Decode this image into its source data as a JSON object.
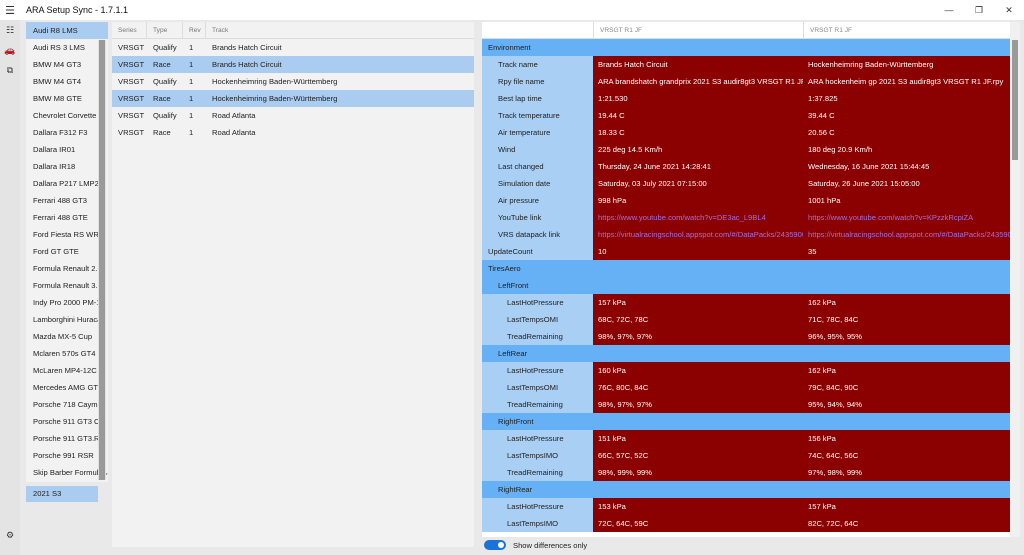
{
  "app": {
    "title": "ARA Setup Sync - 1.7.1.1"
  },
  "window": {
    "minimize": "—",
    "maximize": "❐",
    "close": "✕"
  },
  "cars": [
    "Audi R8 LMS",
    "Audi RS 3 LMS",
    "BMW M4 GT3",
    "BMW M4 GT4",
    "BMW M8 GTE",
    "Chevrolet Corvette C",
    "Dallara F312 F3",
    "Dallara IR01",
    "Dallara IR18",
    "Dallara P217 LMP2",
    "Ferrari 488 GT3",
    "Ferrari 488 GTE",
    "Ford Fiesta RS WRC",
    "Ford GT GTE",
    "Formula Renault 2.0",
    "Formula Renault 3.5",
    "Indy Pro 2000 PM-1",
    "Lamborghini Huraca",
    "Mazda MX-5 Cup",
    "Mclaren 570s GT4",
    "McLaren MP4-12C G",
    "Mercedes AMG GT3",
    "Porsche 718 Cayma",
    "Porsche 911 GT3 Cu",
    "Porsche 911 GT3.R",
    "Porsche 991 RSR",
    "Skip Barber Formula"
  ],
  "selected_car_index": 0,
  "season": "2021 S3",
  "setups": {
    "headers": {
      "series": "Series",
      "type": "Type",
      "rev": "Rev",
      "track": "Track"
    },
    "rows": [
      {
        "series": "VRSGT",
        "type": "Qualify",
        "rev": "1",
        "track": "Brands Hatch Circuit",
        "selected": false
      },
      {
        "series": "VRSGT",
        "type": "Race",
        "rev": "1",
        "track": "Brands Hatch Circuit",
        "selected": true
      },
      {
        "series": "VRSGT",
        "type": "Qualify",
        "rev": "1",
        "track": "Hockenheimring Baden-Württemberg",
        "selected": false
      },
      {
        "series": "VRSGT",
        "type": "Race",
        "rev": "1",
        "track": "Hockenheimring Baden-Württemberg",
        "selected": true
      },
      {
        "series": "VRSGT",
        "type": "Qualify",
        "rev": "1",
        "track": "Road Atlanta",
        "selected": false
      },
      {
        "series": "VRSGT",
        "type": "Race",
        "rev": "1",
        "track": "Road Atlanta",
        "selected": false
      }
    ]
  },
  "compare": {
    "col1": "VRSGT R1 JF",
    "col2": "VRSGT R1 JF",
    "rows": [
      {
        "kind": "group",
        "level": 0,
        "label": "Environment"
      },
      {
        "kind": "row",
        "level": 1,
        "label": "Track name",
        "v1": "Brands Hatch Circuit",
        "v2": "Hockenheimring Baden-Württemberg"
      },
      {
        "kind": "row",
        "level": 1,
        "label": "Rpy file name",
        "v1": "ARA brandshatch grandprix 2021 S3 audir8gt3 VRSGT R1 JF.rpy",
        "v2": "ARA hockenheim gp 2021 S3 audir8gt3 VRSGT R1 JF.rpy"
      },
      {
        "kind": "row",
        "level": 1,
        "label": "Best lap time",
        "v1": "1:21.530",
        "v2": "1:37.825"
      },
      {
        "kind": "row",
        "level": 1,
        "label": "Track temperature",
        "v1": "19.44 C",
        "v2": "39.44 C"
      },
      {
        "kind": "row",
        "level": 1,
        "label": "Air temperature",
        "v1": "18.33 C",
        "v2": "20.56 C"
      },
      {
        "kind": "row",
        "level": 1,
        "label": "Wind",
        "v1": "225 deg 14.5 Km/h",
        "v2": "180 deg 20.9 Km/h"
      },
      {
        "kind": "row",
        "level": 1,
        "label": "Last changed",
        "v1": "Thursday, 24 June 2021 14:28:41",
        "v2": "Wednesday, 16 June 2021 15:44:45"
      },
      {
        "kind": "row",
        "level": 1,
        "label": "Simulation date",
        "v1": "Saturday, 03 July 2021 07:15:00",
        "v2": "Saturday, 26 June 2021 15:05:00"
      },
      {
        "kind": "row",
        "level": 1,
        "label": "Air pressure",
        "v1": "998 hPa",
        "v2": "1001 hPa"
      },
      {
        "kind": "row",
        "level": 1,
        "label": "YouTube link",
        "v1": "https://www.youtube.com/watch?v=DE3ac_L9BL4",
        "v2": "https://www.youtube.com/watch?v=KPzzkRcpiZA",
        "link": true
      },
      {
        "kind": "row",
        "level": 1,
        "label": "VRS datapack link",
        "v1": "https://virtualracingschool.appspot.com/#/DataPacks/2435900",
        "v2": "https://virtualracingschool.appspot.com/#/DataPacks/2435900",
        "link": true
      },
      {
        "kind": "row",
        "level": 0,
        "label": "UpdateCount",
        "v1": "10",
        "v2": "35"
      },
      {
        "kind": "group",
        "level": 0,
        "label": "TiresAero"
      },
      {
        "kind": "group",
        "level": 1,
        "label": "LeftFront"
      },
      {
        "kind": "row",
        "level": 2,
        "label": "LastHotPressure",
        "v1": "157 kPa",
        "v2": "162 kPa"
      },
      {
        "kind": "row",
        "level": 2,
        "label": "LastTempsOMI",
        "v1": "68C, 72C, 78C",
        "v2": "71C, 78C, 84C"
      },
      {
        "kind": "row",
        "level": 2,
        "label": "TreadRemaining",
        "v1": "98%, 97%, 97%",
        "v2": "96%, 95%, 95%"
      },
      {
        "kind": "group",
        "level": 1,
        "label": "LeftRear"
      },
      {
        "kind": "row",
        "level": 2,
        "label": "LastHotPressure",
        "v1": "160 kPa",
        "v2": "162 kPa"
      },
      {
        "kind": "row",
        "level": 2,
        "label": "LastTempsOMI",
        "v1": "76C, 80C, 84C",
        "v2": "79C, 84C, 90C"
      },
      {
        "kind": "row",
        "level": 2,
        "label": "TreadRemaining",
        "v1": "98%, 97%, 97%",
        "v2": "95%, 94%, 94%"
      },
      {
        "kind": "group",
        "level": 1,
        "label": "RightFront"
      },
      {
        "kind": "row",
        "level": 2,
        "label": "LastHotPressure",
        "v1": "151 kPa",
        "v2": "156 kPa"
      },
      {
        "kind": "row",
        "level": 2,
        "label": "LastTempsIMO",
        "v1": "66C, 57C, 52C",
        "v2": "74C, 64C, 56C"
      },
      {
        "kind": "row",
        "level": 2,
        "label": "TreadRemaining",
        "v1": "98%, 99%, 99%",
        "v2": "97%, 98%, 99%"
      },
      {
        "kind": "group",
        "level": 1,
        "label": "RightRear"
      },
      {
        "kind": "row",
        "level": 2,
        "label": "LastHotPressure",
        "v1": "153 kPa",
        "v2": "157 kPa"
      },
      {
        "kind": "row",
        "level": 2,
        "label": "LastTempsIMO",
        "v1": "72C, 64C, 59C",
        "v2": "82C, 72C, 64C"
      }
    ]
  },
  "toggle": {
    "label": "Show differences only",
    "on": true
  },
  "colors": {
    "accent": "#1a73d9",
    "diff_bg": "#8b0000",
    "group_bg": "#66b0f6",
    "label_bg": "#a9cff5",
    "selection": "#a9ccf0"
  },
  "icons": {
    "menu": "hamburger-icon",
    "list": "list-icon",
    "car": "car-icon",
    "copy": "copy-icon",
    "settings": "gear-icon",
    "dropdown": "chevron-down-icon"
  }
}
